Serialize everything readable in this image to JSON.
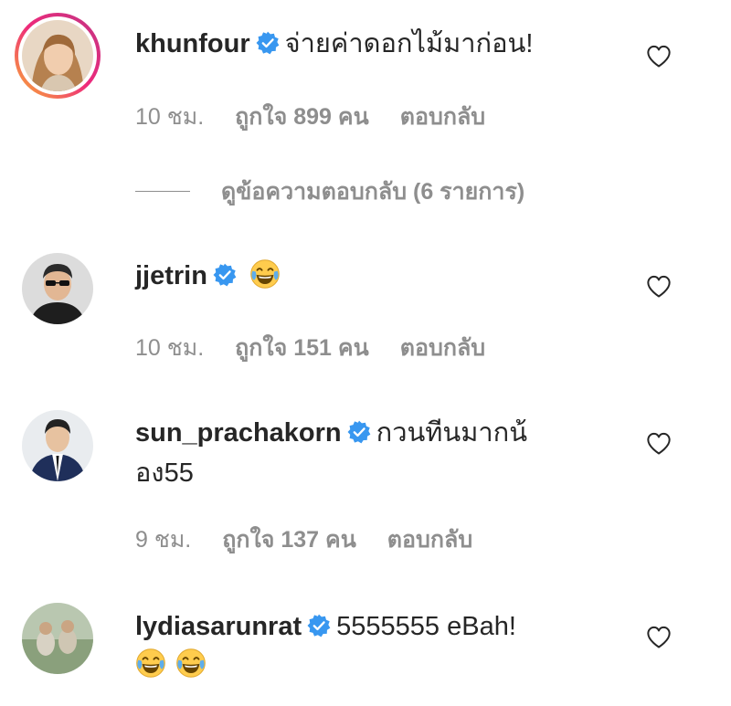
{
  "comments": [
    {
      "username": "khunfour",
      "text": "จ่ายค่าดอกไม้มาก่อน!",
      "time": "10 ชม.",
      "likes": "ถูกใจ 899 คน",
      "reply": "ตอบกลับ",
      "view_replies": "ดูข้อความตอบกลับ (6 รายการ)"
    },
    {
      "username": "jjetrin",
      "text": "",
      "time": "10 ชม.",
      "likes": "ถูกใจ 151 คน",
      "reply": "ตอบกลับ"
    },
    {
      "username": "sun_prachakorn",
      "text": "กวนทีนมากน้",
      "text_line2": "อง55",
      "time": "9 ชม.",
      "likes": "ถูกใจ 137 คน",
      "reply": "ตอบกลับ"
    },
    {
      "username": "lydiasarunrat",
      "text": "5555555 eBah!",
      "text_line2": ""
    }
  ],
  "icons": {
    "verified": "verified-badge-icon",
    "like": "heart-outline-icon",
    "emoji": "face-with-tears-of-joy-emoji"
  },
  "colors": {
    "verified_blue": "#3897f0",
    "meta_gray": "#8e8e8e",
    "text": "#262626"
  }
}
